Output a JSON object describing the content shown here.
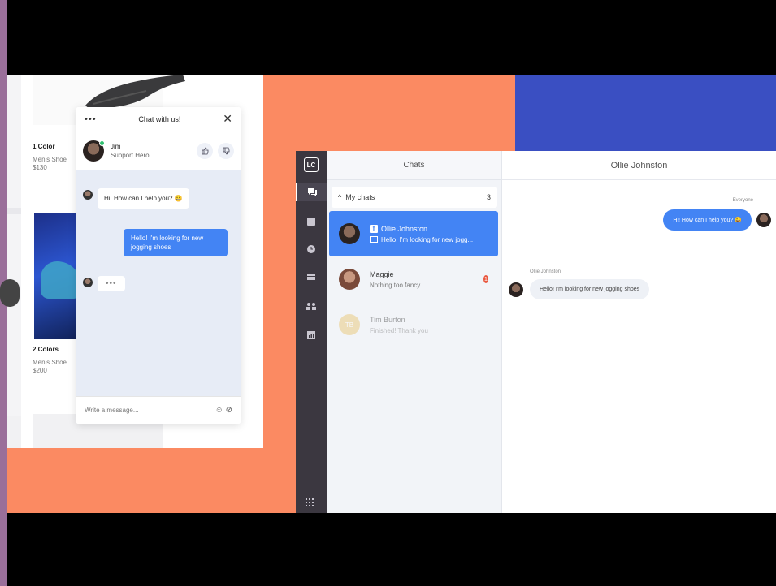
{
  "shop": {
    "products": [
      {
        "colors": "1 Color",
        "name": "Men's Shoe",
        "price": "$130"
      },
      {
        "colors": "2 Colors",
        "name": "Men's Shoe",
        "price": "$200"
      }
    ]
  },
  "widget": {
    "menu": "•••",
    "title": "Chat with us!",
    "close": "✕",
    "agent": {
      "name": "Jim",
      "role": "Support Hero"
    },
    "rate_up": "👍",
    "rate_down": "👎",
    "messages": [
      {
        "from": "agent",
        "text": "Hi! How can I help you? 😀"
      },
      {
        "from": "visitor",
        "text": "Hello! I'm looking for new jogging shoes"
      },
      {
        "from": "agent",
        "text": "•••"
      }
    ],
    "input_placeholder": "Write a message...",
    "input_icons": "☺ ⊘"
  },
  "app": {
    "logo": "LC",
    "nav_icons": [
      "chat-icon",
      "archive-icon",
      "history-icon",
      "tickets-icon",
      "team-icon",
      "reports-icon"
    ],
    "chats_header": "Chats",
    "section": {
      "label": "My chats",
      "chevron": "^",
      "count": "3"
    },
    "chats": [
      {
        "name": "Ollie Johnston",
        "preview": "Hello! I'm looking for new jogg...",
        "fb": "f"
      },
      {
        "name": "Maggie",
        "preview": "Nothing too fancy",
        "badge": "1"
      },
      {
        "name": "Tim Burton",
        "preview": "Finished! Thank you",
        "initials": "TB"
      }
    ],
    "conversation": {
      "title": "Ollie Johnston",
      "agent_label": "Everyone",
      "agent_msg": "Hi! How can I help you? 😀",
      "customer_label": "Ollie Johnston",
      "customer_msg": "Hello! I'm looking for new jogging shoes"
    }
  }
}
